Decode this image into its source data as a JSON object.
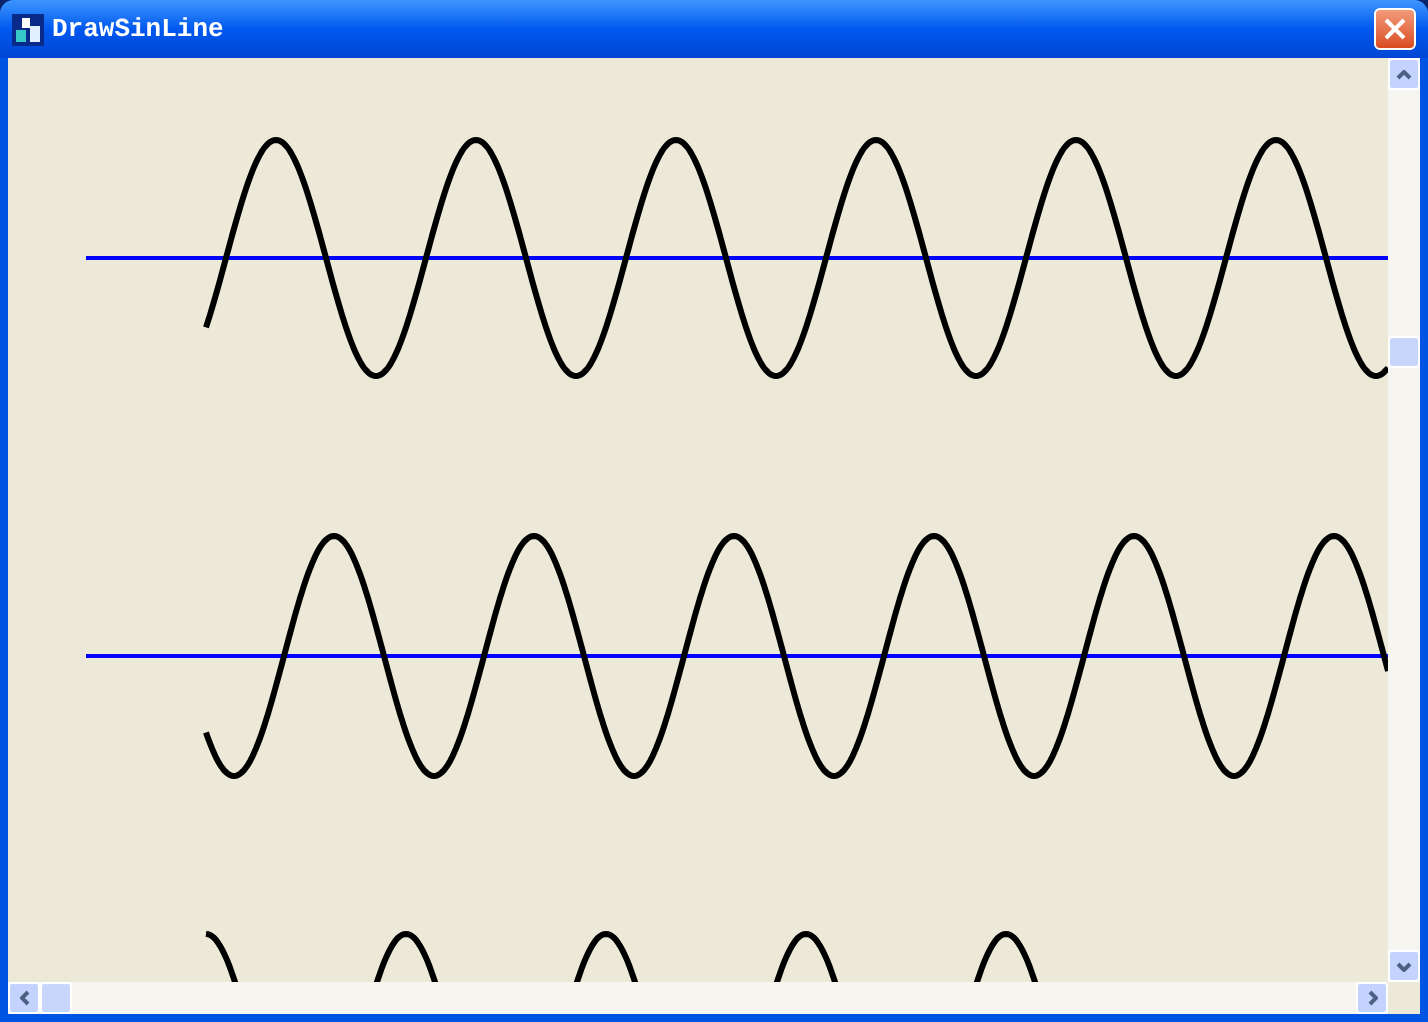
{
  "window": {
    "title": "DrawSinLine"
  }
}
